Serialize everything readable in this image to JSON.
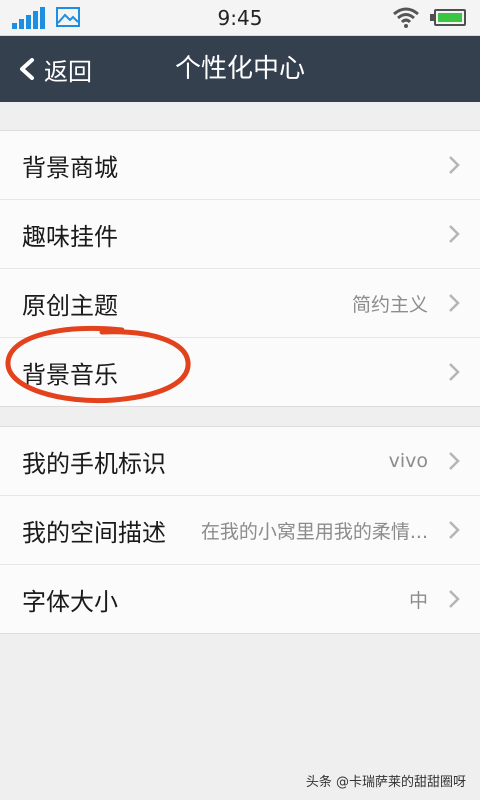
{
  "status_bar": {
    "time": "9:45",
    "icons": [
      "signal-icon",
      "picture-icon",
      "wifi-icon",
      "battery-icon"
    ],
    "accent_color": "#1e8fe0",
    "battery_color": "#39c640"
  },
  "header": {
    "back_label": "返回",
    "title": "个性化中心",
    "background_color": "#35404f"
  },
  "groups": [
    {
      "items": [
        {
          "label": "背景商城",
          "value": ""
        },
        {
          "label": "趣味挂件",
          "value": ""
        },
        {
          "label": "原创主题",
          "value": "简约主义"
        },
        {
          "label": "背景音乐",
          "value": ""
        }
      ]
    },
    {
      "items": [
        {
          "label": "我的手机标识",
          "value": "vivo"
        },
        {
          "label": "我的空间描述",
          "value": "在我的小窝里用我的柔情..."
        },
        {
          "label": "字体大小",
          "value": "中"
        }
      ]
    }
  ],
  "annotation": {
    "shape": "ellipse",
    "color": "#e2421c",
    "target": "背景音乐"
  },
  "watermark": "头条 @卡瑞萨莱的甜甜圈呀"
}
